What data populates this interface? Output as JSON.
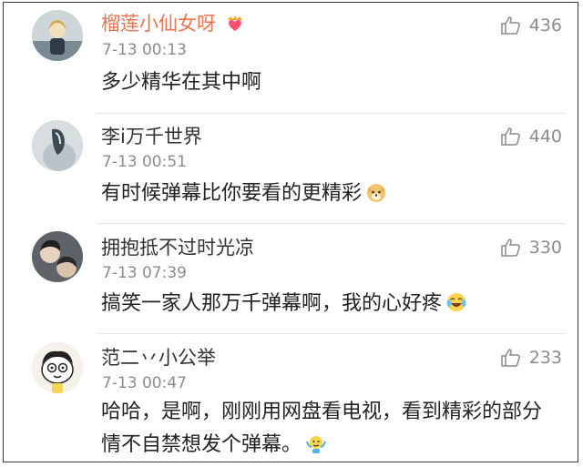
{
  "comments": [
    {
      "user": "榴莲小仙女呀",
      "time": "7-13 00:13",
      "text": "多少精华在其中啊",
      "likes": "436",
      "emoji": ""
    },
    {
      "user": "李i万千世界",
      "time": "7-13 00:51",
      "text": "有时候弹幕比你要看的更精彩",
      "likes": "440",
      "emoji": "doge-emoji"
    },
    {
      "user": "拥抱抵不过时光凉",
      "time": "7-13 07:39",
      "text": "搞笑一家人那万千弹幕啊，我的心好疼",
      "likes": "330",
      "emoji": "laugh-cry-emoji"
    },
    {
      "user": "范二丷小公举",
      "time": "7-13 00:47",
      "text": "哈哈，是啊，刚刚用网盘看电视，看到精彩的部分情不自禁想发个弹幕。",
      "likes": "233",
      "emoji": "shrug-emoji"
    }
  ],
  "colors": {
    "vip_name": "#eb7350",
    "name": "#333333",
    "meta": "#8c8c8c",
    "text": "#222222"
  },
  "icons": {
    "like": "thumbs-up-icon",
    "vip_badge": "crown-heart-icon"
  }
}
